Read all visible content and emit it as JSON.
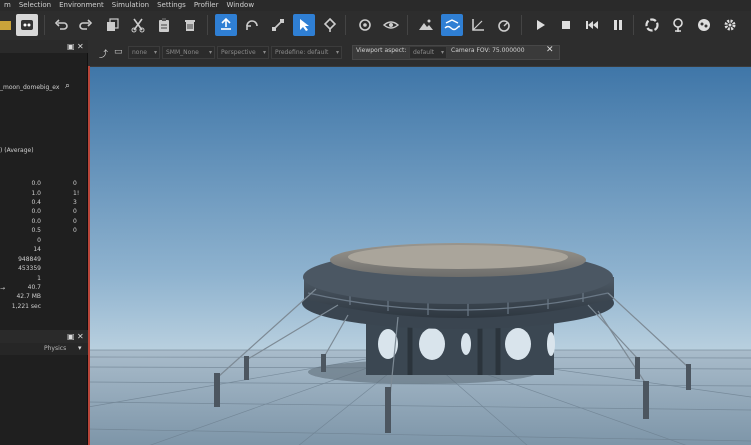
{
  "menu": [
    "m",
    "Selection",
    "Environment",
    "Simulation",
    "Settings",
    "Profiler",
    "Window"
  ],
  "toolbar": {
    "buttons": [
      "undo-icon",
      "redo-icon",
      "copy-icon",
      "cut-icon",
      "paste-icon",
      "delete-icon",
      "add-entity-icon",
      "rotate-icon",
      "scale-icon",
      "select-icon",
      "move-icon",
      "focus-icon",
      "eye-icon",
      "terrain-icon",
      "sea-icon",
      "snap-icon",
      "camera-icon",
      "play-icon",
      "stop-icon",
      "rewind-icon",
      "pause-icon",
      "refresh-icon",
      "marker-icon",
      "network-icon",
      "gear-icon"
    ]
  },
  "left_panel": {
    "asset_name": "_moon_domebig_ex",
    "avg_label": ") (Average)",
    "stats_col1": [
      "0.0",
      "1.0",
      "0.4",
      "0.0",
      "0.0",
      "0.5",
      "0",
      "14",
      "948849",
      "453359",
      "1",
      "40.7",
      "42.7 MB",
      "1,221 sec"
    ],
    "stats_col2": [
      "0",
      "1!",
      "3",
      "0",
      "0",
      "0",
      "",
      "",
      "",
      "",
      "",
      "",
      "",
      ""
    ],
    "arrow_label": "→",
    "tab_physics": "Physics",
    "pin": "▾"
  },
  "viewport_toolbar": {
    "dropdowns": [
      {
        "label": "none"
      },
      {
        "label": "SMM_None"
      },
      {
        "label": "Perspective"
      },
      {
        "label": "Predefine: default"
      }
    ],
    "aspect_label": "Viewport aspect:",
    "aspect_value": "default",
    "camera_fov": "Camera FOV: 75.000000",
    "close": "✕"
  },
  "colors": {
    "accent": "#2f7fd4",
    "sky_top": "#3f76a8",
    "sky_bottom": "#b9d0df",
    "viewport_border": "#b8463a"
  }
}
